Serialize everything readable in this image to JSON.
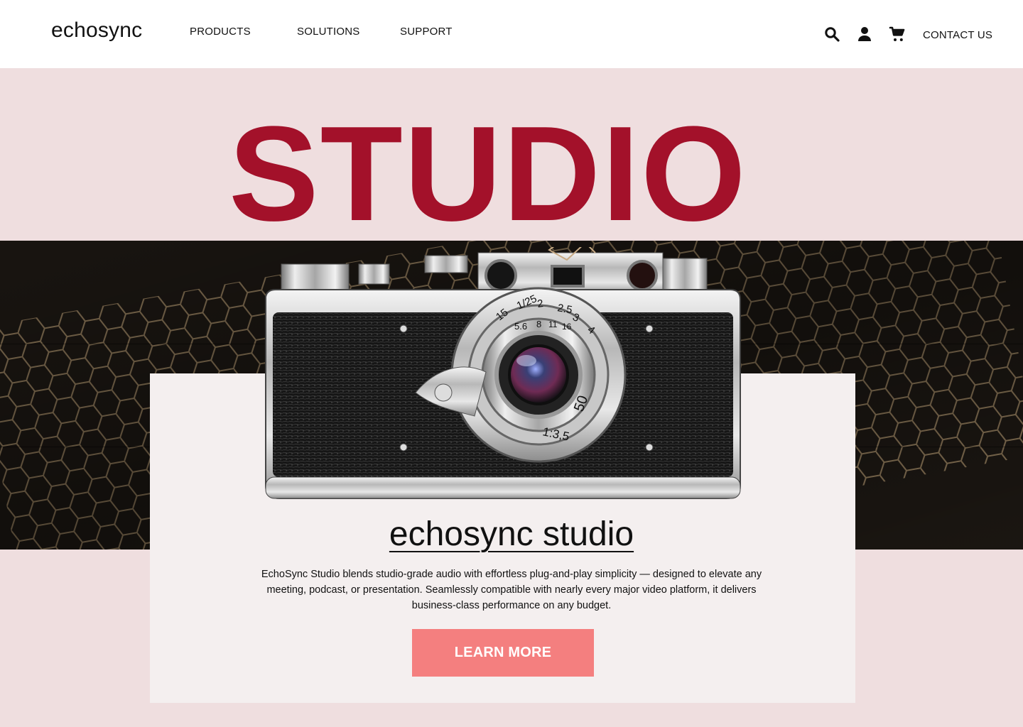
{
  "header": {
    "logo": "echosync",
    "nav": {
      "products": "PRODUCTS",
      "solutions": "SOLUTIONS",
      "support": "SUPPORT"
    },
    "icons": [
      "search-icon",
      "user-icon",
      "cart-icon"
    ],
    "contact": "CONTACT US"
  },
  "hero": {
    "title": "STUDIO"
  },
  "product": {
    "name": "echosync studio",
    "description": "EchoSync Studio blends studio-grade audio with effortless plug-and-play simplicity — designed to elevate any meeting, podcast, or presentation. Seamlessly compatible with nearly every major video platform, it delivers business-class performance on any budget.",
    "cta": "LEARN MORE",
    "image": "camera-image"
  },
  "colors": {
    "page_background": "#efdedf",
    "header_background": "#ffffff",
    "title": "#a3112a",
    "card_background": "#f4efef",
    "button": "#f47f7f",
    "button_text": "#ffffff"
  },
  "camera_markings": {
    "top_dial": [
      "15",
      "1/25",
      "2",
      "2.5",
      "3",
      "4",
      "5.6",
      "8",
      "11",
      "16"
    ],
    "lens_text": "1:3,5",
    "focal_length": "50"
  }
}
